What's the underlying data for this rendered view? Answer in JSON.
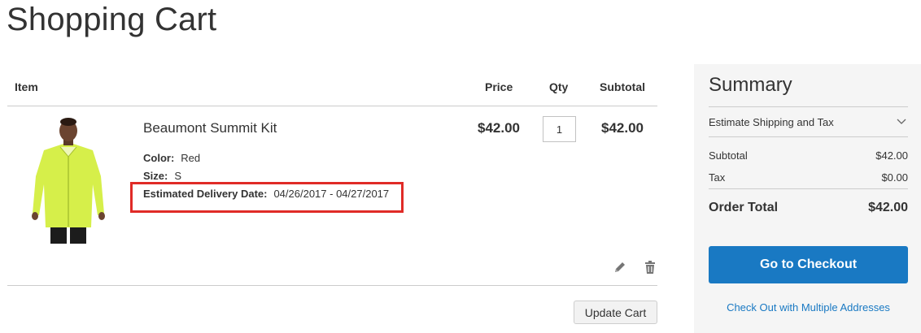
{
  "page": {
    "title": "Shopping Cart"
  },
  "cart": {
    "columns": {
      "item": "Item",
      "price": "Price",
      "qty": "Qty",
      "subtotal": "Subtotal"
    },
    "items": [
      {
        "name": "Beaumont Summit Kit",
        "options": [
          {
            "label": "Color:",
            "value": "Red"
          },
          {
            "label": "Size:",
            "value": "S"
          },
          {
            "label": "Estimated Delivery Date:",
            "value": "04/26/2017 - 04/27/2017"
          }
        ],
        "price": "$42.00",
        "qty": "1",
        "subtotal": "$42.00",
        "actions": {
          "edit_icon": "pencil-icon",
          "remove_icon": "trash-icon"
        }
      }
    ],
    "update_label": "Update Cart"
  },
  "summary": {
    "title": "Summary",
    "shipping_label": "Estimate Shipping and Tax",
    "shipping_icon": "chevron-down-icon",
    "rows": [
      {
        "label": "Subtotal",
        "value": "$42.00"
      },
      {
        "label": "Tax",
        "value": "$0.00"
      }
    ],
    "total": {
      "label": "Order Total",
      "value": "$42.00"
    },
    "checkout_label": "Go to Checkout",
    "multi_address_label": "Check Out with Multiple Addresses"
  },
  "colors": {
    "primary": "#1979c3",
    "highlight": "#e02b27",
    "jacket": "#d6ef4a"
  }
}
